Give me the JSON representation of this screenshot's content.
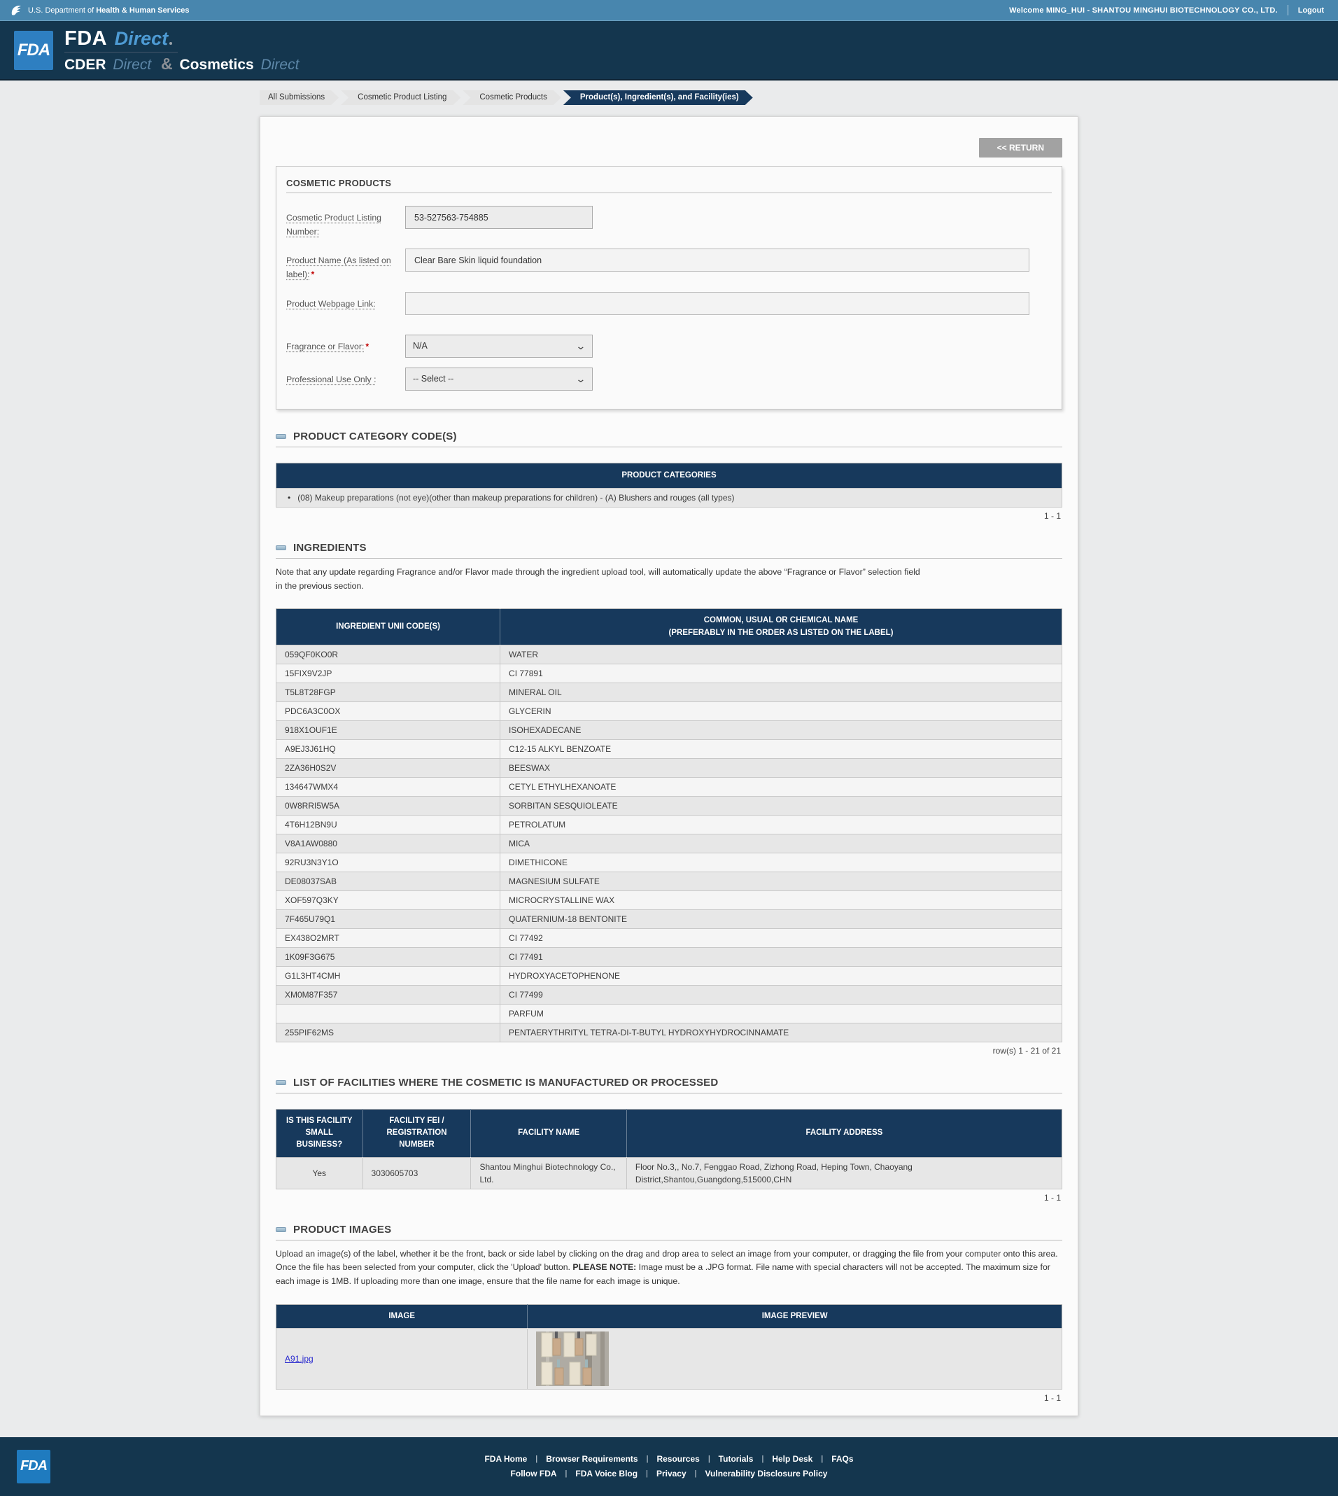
{
  "topbar": {
    "agency_prefix": "U.S. Department of",
    "agency_name": "Health & Human Services",
    "welcome": "Welcome MING_HUI - SHANTOU MINGHUI BIOTECHNOLOGY CO., LTD.",
    "logout": "Logout"
  },
  "header": {
    "logo_text": "FDA",
    "fda": "FDA",
    "direct": "Direct",
    "cder": "CDER",
    "cder_direct": "Direct",
    "amp": "&",
    "cosmetics": "Cosmetics",
    "cosmetics_direct": "Direct"
  },
  "breadcrumbs": [
    "All Submissions",
    "Cosmetic Product Listing",
    "Cosmetic Products",
    "Product(s), Ingredient(s), and Facility(ies)"
  ],
  "toolbar": {
    "return_label": "<< RETURN"
  },
  "form": {
    "title": "COSMETIC PRODUCTS",
    "required_marker": "*",
    "listing_number": {
      "label": "Cosmetic Product Listing Number:",
      "value": "53-527563-754885"
    },
    "product_name": {
      "label": "Product Name (As listed on label):",
      "value": "Clear Bare Skin liquid foundation"
    },
    "webpage": {
      "label": "Product Webpage Link:",
      "value": ""
    },
    "fragrance": {
      "label": "Fragrance or Flavor:",
      "value": "N/A"
    },
    "professional": {
      "label": "Professional Use Only :",
      "value": "-- Select --"
    }
  },
  "categories": {
    "section_title": "PRODUCT CATEGORY CODE(S)",
    "header": "PRODUCT CATEGORIES",
    "rows": [
      "(08) Makeup preparations (not eye)(other than makeup preparations for children) - (A) Blushers and rouges (all types)"
    ],
    "pagination": "1 - 1"
  },
  "ingredients": {
    "section_title": "INGREDIENTS",
    "note": "Note that any update regarding Fragrance and/or Flavor made through the ingredient upload tool, will automatically update the above “Fragrance or Flavor” selection field\nin the previous section.",
    "header_code": "INGREDIENT UNII CODE(S)",
    "header_name_line1": "COMMON, USUAL OR CHEMICAL NAME",
    "header_name_line2": "(PREFERABLY IN THE ORDER AS LISTED ON THE LABEL)",
    "rows": [
      {
        "code": "059QF0KO0R",
        "name": "WATER"
      },
      {
        "code": "15FIX9V2JP",
        "name": "CI 77891"
      },
      {
        "code": "T5L8T28FGP",
        "name": "MINERAL OIL"
      },
      {
        "code": "PDC6A3C0OX",
        "name": "GLYCERIN"
      },
      {
        "code": "918X1OUF1E",
        "name": "ISOHEXADECANE"
      },
      {
        "code": "A9EJ3J61HQ",
        "name": "C12-15 ALKYL BENZOATE"
      },
      {
        "code": "2ZA36H0S2V",
        "name": "BEESWAX"
      },
      {
        "code": "134647WMX4",
        "name": "CETYL ETHYLHEXANOATE"
      },
      {
        "code": "0W8RRI5W5A",
        "name": "SORBITAN SESQUIOLEATE"
      },
      {
        "code": "4T6H12BN9U",
        "name": "PETROLATUM"
      },
      {
        "code": "V8A1AW0880",
        "name": "MICA"
      },
      {
        "code": "92RU3N3Y1O",
        "name": "DIMETHICONE"
      },
      {
        "code": "DE08037SAB",
        "name": "MAGNESIUM SULFATE"
      },
      {
        "code": "XOF597Q3KY",
        "name": "MICROCRYSTALLINE WAX"
      },
      {
        "code": "7F465U79Q1",
        "name": "QUATERNIUM-18 BENTONITE"
      },
      {
        "code": "EX438O2MRT",
        "name": "CI 77492"
      },
      {
        "code": "1K09F3G675",
        "name": "CI 77491"
      },
      {
        "code": "G1L3HT4CMH",
        "name": "HYDROXYACETOPHENONE"
      },
      {
        "code": "XM0M87F357",
        "name": "CI 77499"
      },
      {
        "code": "",
        "name": "PARFUM"
      },
      {
        "code": "255PIF62MS",
        "name": "PENTAERYTHRITYL TETRA-DI-T-BUTYL HYDROXYHYDROCINNAMATE"
      }
    ],
    "pagination": "row(s) 1 - 21 of 21"
  },
  "facilities": {
    "section_title": "LIST OF FACILITIES WHERE THE COSMETIC IS MANUFACTURED OR PROCESSED",
    "headers": {
      "small_business": "IS THIS FACILITY SMALL BUSINESS?",
      "fei": "FACILITY FEI / REGISTRATION NUMBER",
      "name": "FACILITY NAME",
      "address": "FACILITY ADDRESS"
    },
    "rows": [
      {
        "small_business": "Yes",
        "fei": "3030605703",
        "name": "Shantou Minghui Biotechnology Co., Ltd.",
        "address": "Floor No.3,, No.7, Fenggao Road, Zizhong Road, Heping Town, Chaoyang District,Shantou,Guangdong,515000,CHN"
      }
    ],
    "pagination": "1 - 1"
  },
  "images": {
    "section_title": "PRODUCT IMAGES",
    "note_before": "Upload an image(s) of the label, whether it be the front, back or side label by clicking on the drag and drop area to select an image from your computer, or dragging the file from your computer onto this area. Once the file has been selected from your computer, click the 'Upload' button. ",
    "note_bold": "PLEASE NOTE:",
    "note_after": " Image must be a .JPG format. File name with special characters will not be accepted. The maximum size for each image is 1MB. If uploading more than one image, ensure that the file name for each image is unique.",
    "header_image": "IMAGE",
    "header_preview": "IMAGE PREVIEW",
    "rows": [
      {
        "file": "A91.jpg"
      }
    ],
    "pagination": "1 - 1"
  },
  "footer": {
    "logo_text": "FDA",
    "links_row1": [
      "FDA Home",
      "Browser Requirements",
      "Resources",
      "Tutorials",
      "Help Desk",
      "FAQs"
    ],
    "links_row2": [
      "Follow FDA",
      "FDA Voice Blog",
      "Privacy",
      "Vulnerability Disclosure Policy"
    ]
  },
  "colors": {
    "topbar_blue": "#4886ae",
    "navy": "#14364e",
    "table_header_navy": "#17395c",
    "fda_logo_blue": "#2e7fc1",
    "link_blue": "#2b2bcf",
    "required_red": "#c00000",
    "row_gray": "#e7e7e7"
  }
}
